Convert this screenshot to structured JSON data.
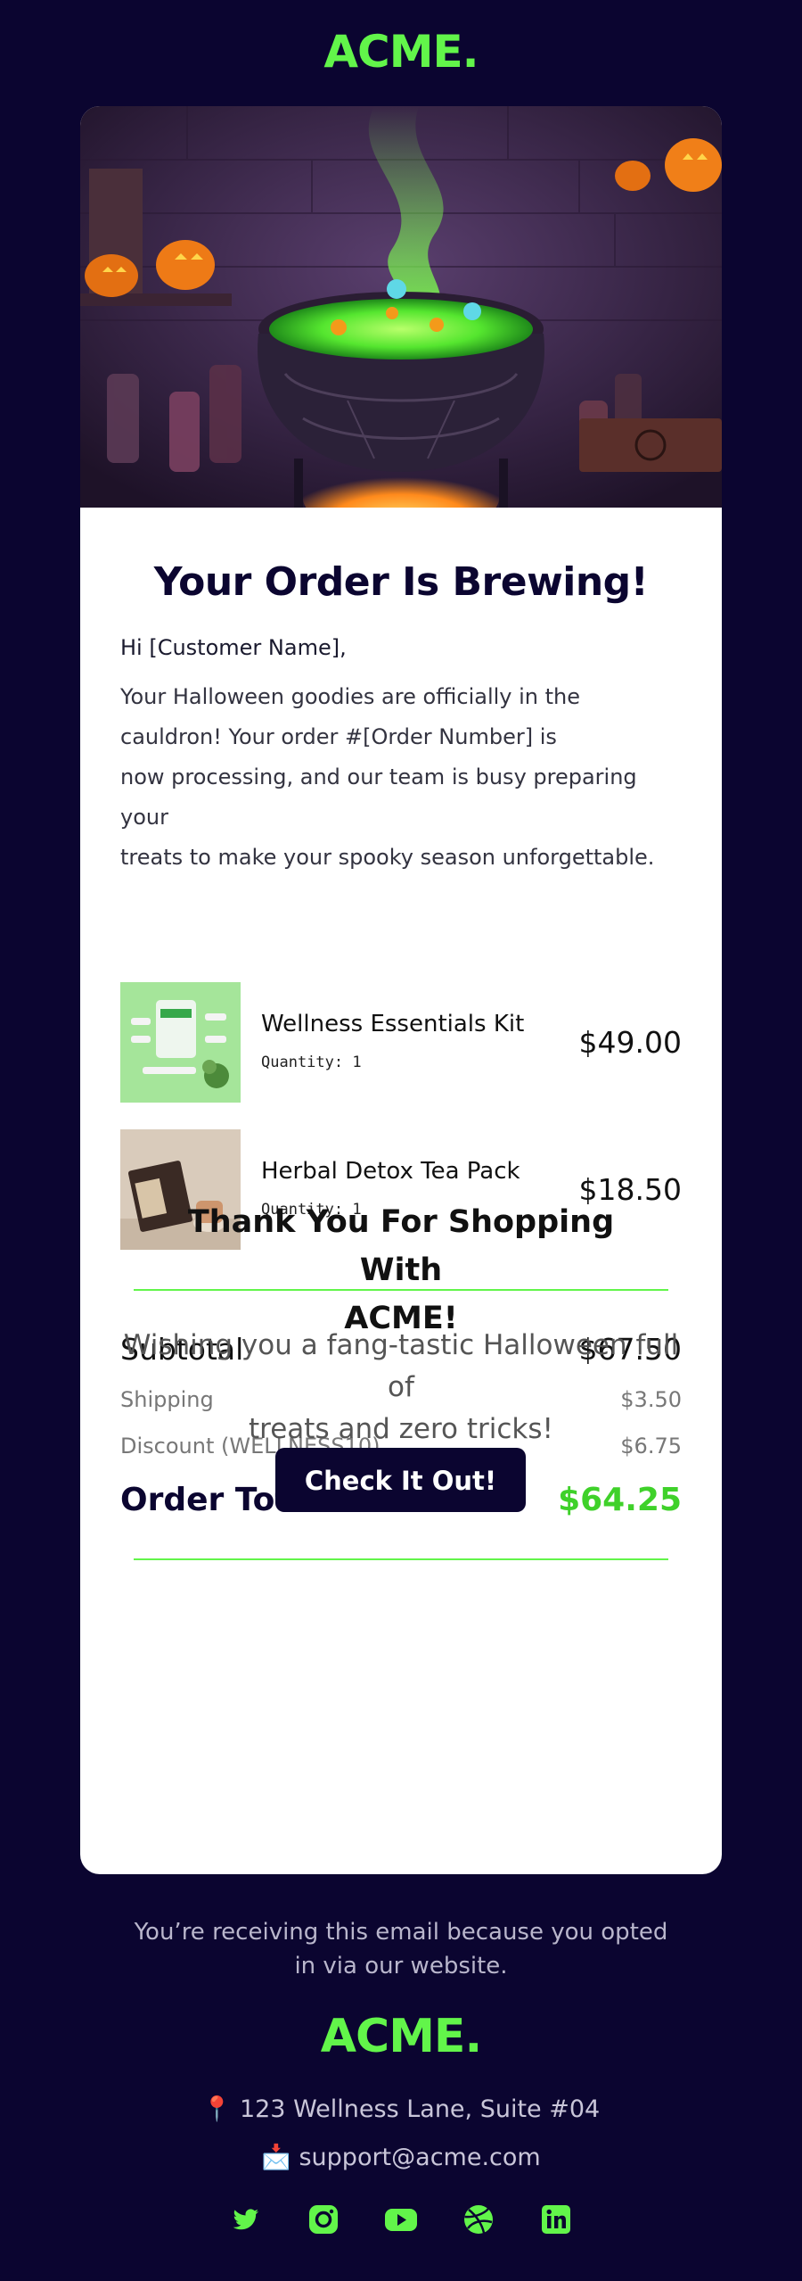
{
  "brand": {
    "logo": "ACME.",
    "accent": "#62f54a",
    "dark": "#0b0530"
  },
  "hero": {
    "image": "witch-cauldron-halloween"
  },
  "email": {
    "headline": "Your Order Is Brewing!",
    "greeting": "Hi [Customer Name],",
    "body_lines": [
      "Your Halloween goodies are officially in the",
      "cauldron! Your order #[Order Number] is",
      "now processing, and our team is busy preparing your",
      "treats to make your spooky season unforgettable."
    ]
  },
  "items": [
    {
      "name": "Wellness Essentials Kit",
      "quantity": "Quantity: 1",
      "price": "$49.00",
      "thumb": "wellness-kit-image"
    },
    {
      "name": "Herbal Detox Tea Pack",
      "quantity": "Quantity: 1",
      "price": "$18.50",
      "thumb": "tea-pack-image"
    }
  ],
  "summary": {
    "subtotal_label": "Subtotal",
    "subtotal": "$67.50",
    "shipping_label": "Shipping",
    "shipping": "$3.50",
    "discount_label": "Discount (WELLNESS10)",
    "discount": "$6.75",
    "total_label": "Order Total",
    "total": "$64.25"
  },
  "thanks": {
    "title_lines": [
      "Thank You For Shopping With",
      "ACME!"
    ],
    "message_lines": [
      "Wishing you a fang-tastic Halloween full of",
      "treats and zero tricks!"
    ],
    "cta": "Check It Out!"
  },
  "footer": {
    "note_lines": [
      "You’re receiving this email because you opted",
      "in via our website."
    ],
    "logo": "ACME.",
    "address": "📍 123 Wellness Lane, Suite #04",
    "email": "📩 support@acme.com",
    "socials": [
      "twitter-icon",
      "instagram-icon",
      "youtube-icon",
      "dribbble-icon",
      "linkedin-icon"
    ]
  }
}
